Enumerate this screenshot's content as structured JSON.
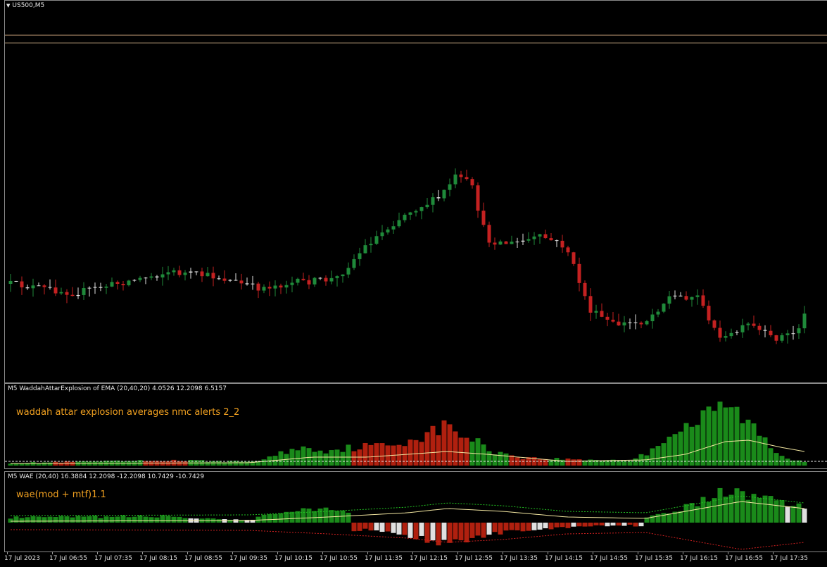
{
  "chart": {
    "symbol_title": "US500,M5",
    "indicator1_title": "M5 WaddahAttarExplosion of EMA (20,40,20) 4.0526 12.2098 6.5157",
    "indicator1_caption": "waddah attar explosion averages nmc alerts 2_2",
    "indicator2_title": "M5 WAE (20,40) 16.3884 12.2098 -12.2098 10.7429 -10.7429",
    "indicator2_caption": "wae(mod + mtf)1.1",
    "time_labels": [
      "17 Jul 2023",
      "17 Jul 06:55",
      "17 Jul 07:35",
      "17 Jul 08:15",
      "17 Jul 08:55",
      "17 Jul 09:35",
      "17 Jul 10:15",
      "17 Jul 10:55",
      "17 Jul 11:35",
      "17 Jul 12:15",
      "17 Jul 12:55",
      "17 Jul 13:35",
      "17 Jul 14:15",
      "17 Jul 14:55",
      "17 Jul 15:35",
      "17 Jul 16:15",
      "17 Jul 16:55",
      "17 Jul 17:35"
    ]
  },
  "colors": {
    "background": "#000000",
    "bull_candle": "#1f8a3a",
    "bear_candle": "#c42121",
    "doji": "#e0e0e0",
    "hist_green": "#1a8a1a",
    "hist_red": "#b0200f",
    "hist_white": "#e0e0e0",
    "signal_line": "#f2e6a0",
    "level_line": "#c8a07a",
    "caption": "#f0a020"
  }
}
